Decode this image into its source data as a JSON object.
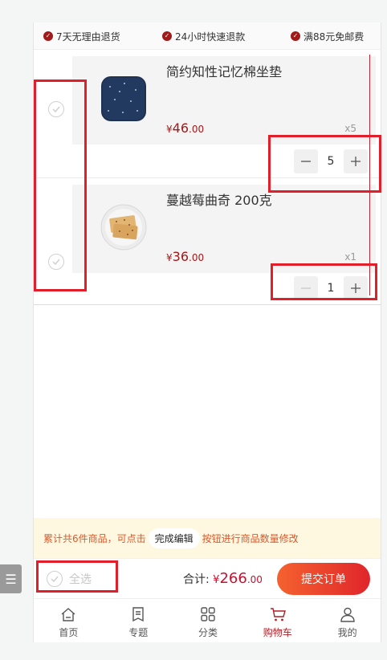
{
  "perks": [
    "7天无理由退货",
    "24小时快速退款",
    "满88元免邮费"
  ],
  "items": [
    {
      "name": "简约知性记忆棉坐垫",
      "currency": "¥",
      "price_int": "46",
      "price_dec": ".00",
      "qty_label": "x5",
      "qty": "5"
    },
    {
      "name": "蔓越莓曲奇 200克",
      "currency": "¥",
      "price_int": "36",
      "price_dec": ".00",
      "qty_label": "x1",
      "qty": "1"
    }
  ],
  "hint": {
    "before": "累计共6件商品，可点击",
    "button": "完成编辑",
    "after": "按钮进行商品数量修改"
  },
  "checkout": {
    "select_all": "全选",
    "total_label": "合计:",
    "currency": "¥",
    "total_int": "266",
    "total_dec": ".00",
    "submit": "提交订单"
  },
  "tabs": [
    {
      "label": "首页",
      "icon": "home-icon"
    },
    {
      "label": "专题",
      "icon": "topic-icon"
    },
    {
      "label": "分类",
      "icon": "category-icon"
    },
    {
      "label": "购物车",
      "icon": "cart-icon",
      "active": true
    },
    {
      "label": "我的",
      "icon": "profile-icon"
    }
  ],
  "side_menu": "☰",
  "colors": {
    "brand": "#b11d25",
    "price": "#a01a1a",
    "highlight": "#e21e2a",
    "hint_bg": "#fff8e1"
  }
}
